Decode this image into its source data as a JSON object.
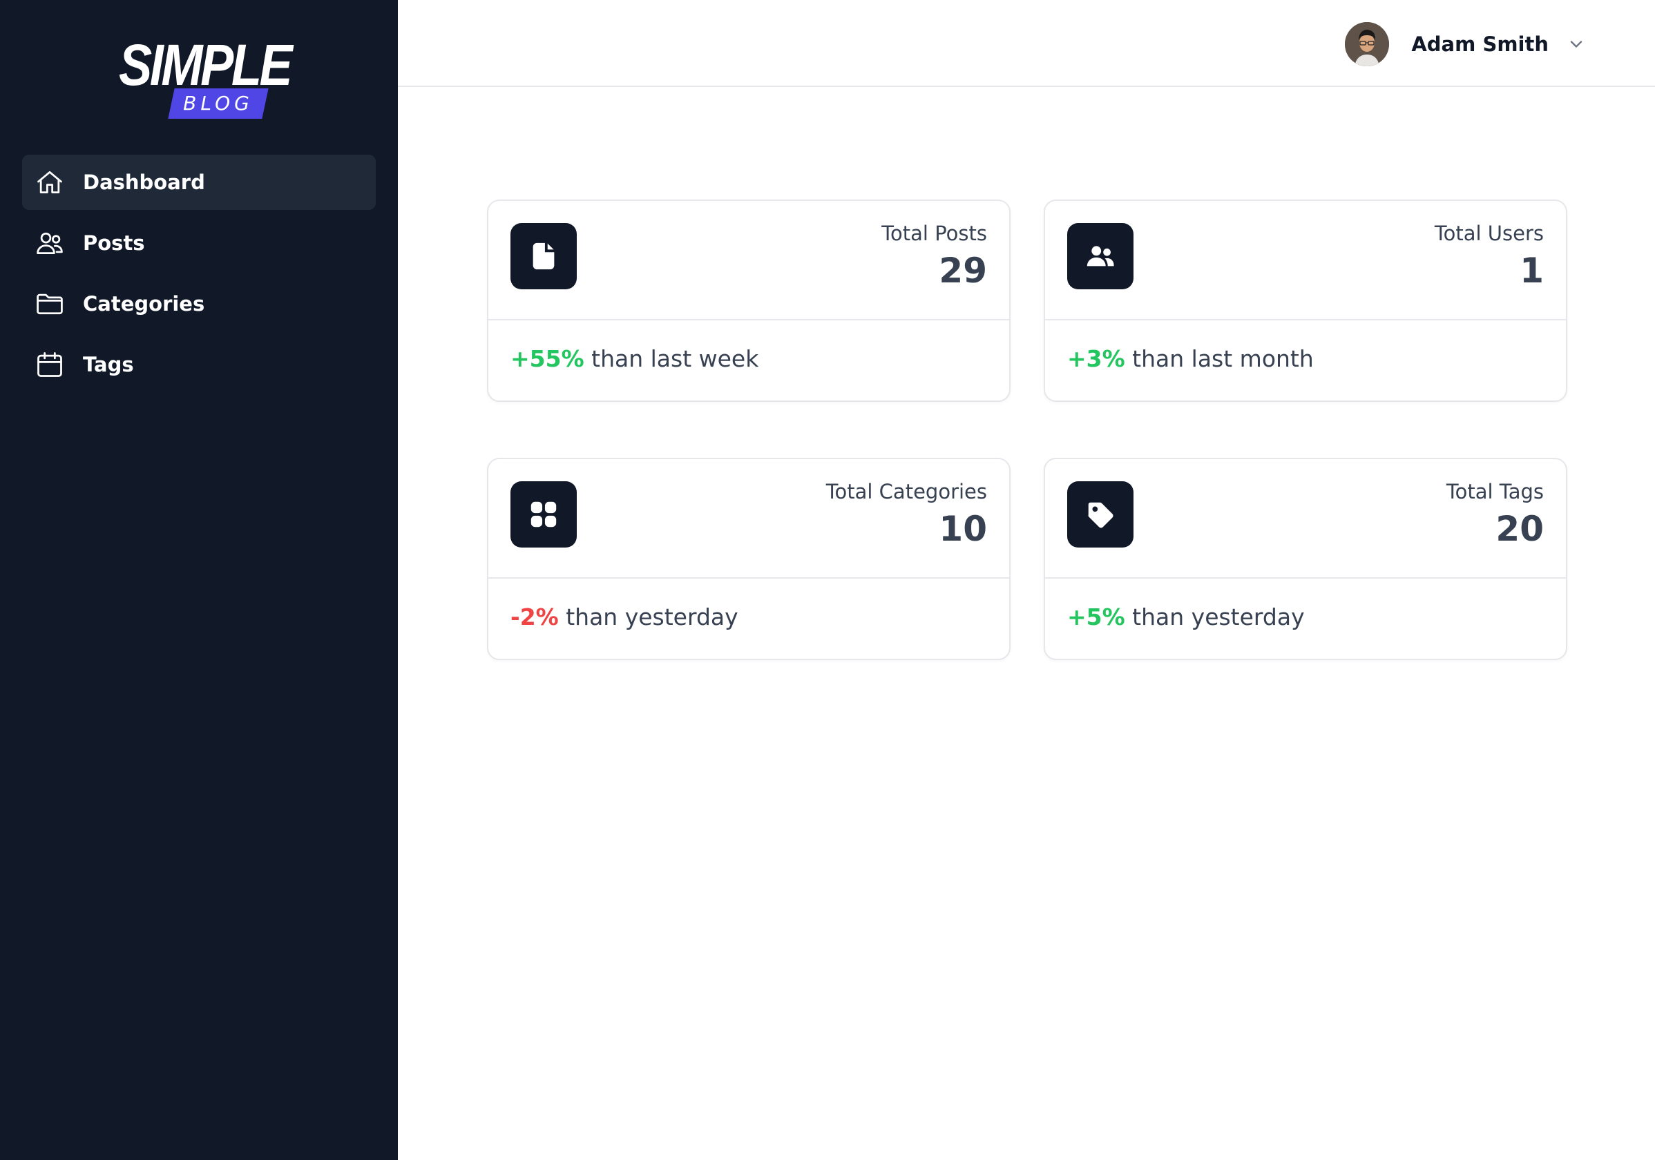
{
  "brand": {
    "word": "SIMPLE",
    "tag": "BLOG",
    "accent": "#4f46e5"
  },
  "sidebar": {
    "items": [
      {
        "label": "Dashboard",
        "icon": "home-icon",
        "active": true
      },
      {
        "label": "Posts",
        "icon": "users-outline-icon",
        "active": false
      },
      {
        "label": "Categories",
        "icon": "folder-icon",
        "active": false
      },
      {
        "label": "Tags",
        "icon": "calendar-icon",
        "active": false
      }
    ]
  },
  "header": {
    "user_name": "Adam Smith"
  },
  "stats": [
    {
      "title": "Total Posts",
      "value": "29",
      "change": "+55%",
      "suffix": " than last week",
      "trend": "up",
      "icon": "document-icon"
    },
    {
      "title": "Total Users",
      "value": "1",
      "change": "+3%",
      "suffix": " than last month",
      "trend": "up",
      "icon": "users-icon"
    },
    {
      "title": "Total Categories",
      "value": "10",
      "change": "-2%",
      "suffix": " than yesterday",
      "trend": "down",
      "icon": "grid-icon"
    },
    {
      "title": "Total Tags",
      "value": "20",
      "change": "+5%",
      "suffix": " than yesterday",
      "trend": "up",
      "icon": "tag-icon"
    }
  ],
  "colors": {
    "sidebar_bg": "#111827",
    "positive": "#22c55e",
    "negative": "#ef4444",
    "text": "#374151"
  }
}
